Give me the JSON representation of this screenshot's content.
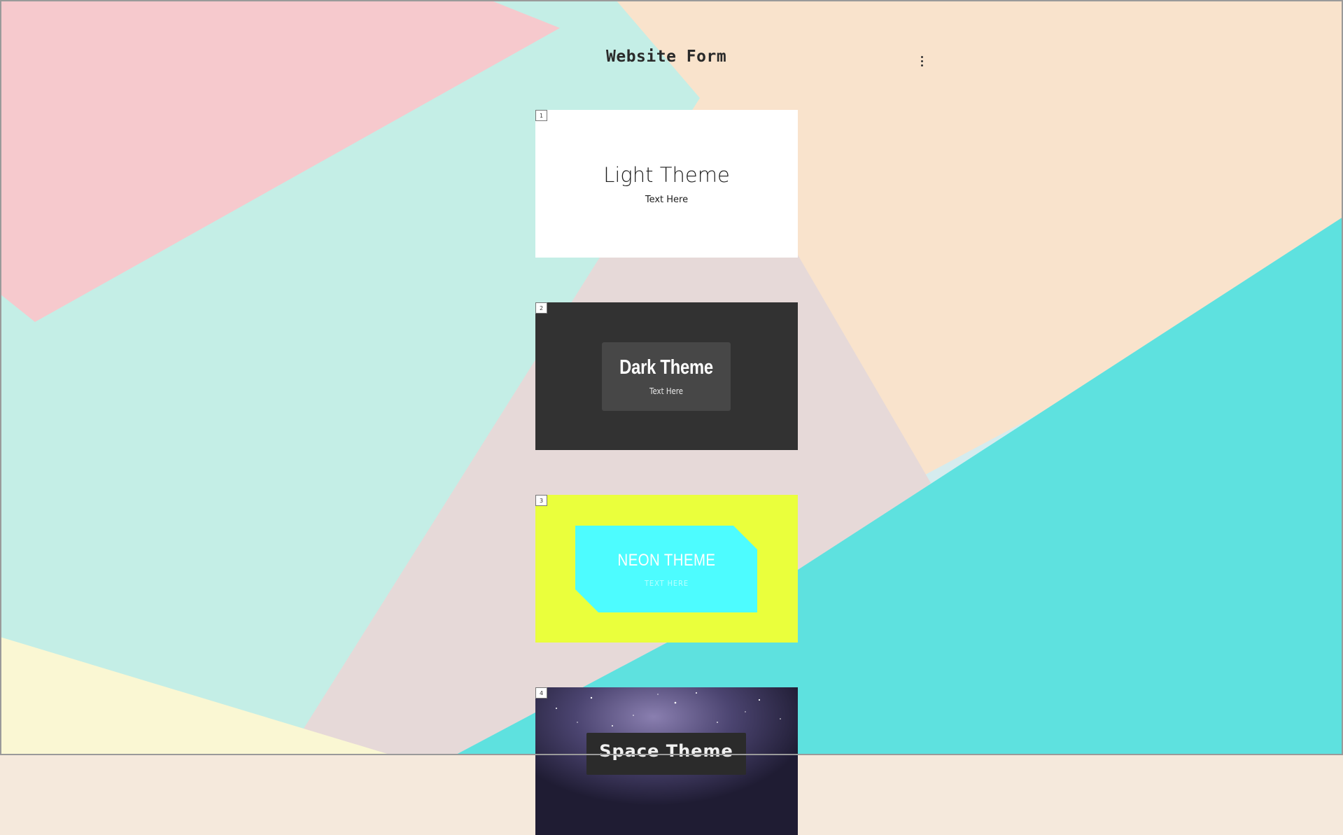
{
  "header": {
    "title": "Website Form"
  },
  "slides": [
    {
      "number": "1",
      "title": "Light Theme",
      "subtitle": "Text Here"
    },
    {
      "number": "2",
      "title": "Dark Theme",
      "subtitle": "Text Here"
    },
    {
      "number": "3",
      "title": "NEON THEME",
      "subtitle": "TEXT HERE"
    },
    {
      "number": "4",
      "title": "Space Theme"
    }
  ],
  "icons": {
    "menu": "more-vertical-icon"
  },
  "colors": {
    "light_bg": "#ffffff",
    "dark_bg": "#323232",
    "dark_box": "#474747",
    "neon_bg": "#eaff3c",
    "neon_shape": "#4dfcff",
    "space_bg": "#2e2a45"
  }
}
